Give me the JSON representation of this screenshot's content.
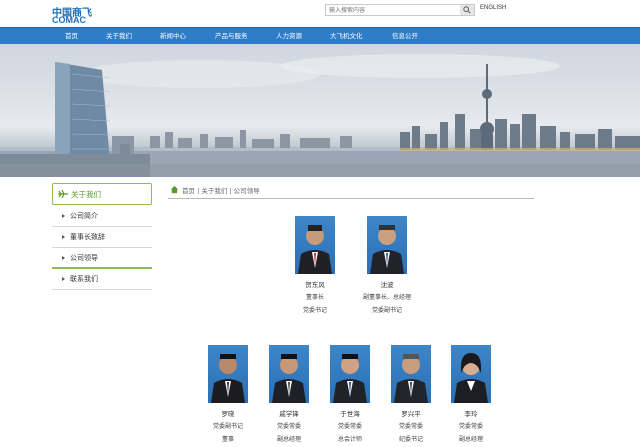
{
  "brand": {
    "name_cn": "中国商飞",
    "name_en": "COMAC",
    "accent": "#2d7dc8",
    "green": "#8bbf5a"
  },
  "search": {
    "placeholder": "输入搜索内容",
    "english_label": "ENGLISH"
  },
  "nav": {
    "items": [
      {
        "label": "首页"
      },
      {
        "label": "关于我们"
      },
      {
        "label": "新闻中心"
      },
      {
        "label": "产品与服务"
      },
      {
        "label": "人力资源"
      },
      {
        "label": "大飞机文化"
      },
      {
        "label": "信息公开"
      }
    ]
  },
  "sidebar": {
    "title": "关于我们",
    "items": [
      {
        "label": "公司简介"
      },
      {
        "label": "董事长致辞"
      },
      {
        "label": "公司领导",
        "active": true
      },
      {
        "label": "联系我们"
      }
    ]
  },
  "breadcrumb": {
    "text": "首页 | 关于我们 | 公司领导"
  },
  "leaders": [
    {
      "name": "贺东风",
      "role1": "董事长",
      "role2": "党委书记",
      "role3": ""
    },
    {
      "name": "沈波",
      "role1": "副董事长、总经理",
      "role2": "党委副书记",
      "role3": ""
    },
    {
      "name": "罗晓",
      "role1": "党委副书记",
      "role2": "董事",
      "role3": ""
    },
    {
      "name": "戚学锋",
      "role1": "党委常委",
      "role2": "副总经理",
      "role3": ""
    },
    {
      "name": "于世海",
      "role1": "党委常委",
      "role2": "总会计师",
      "role3": ""
    },
    {
      "name": "罗兴平",
      "role1": "党委常委",
      "role2": "纪委书记",
      "role3": ""
    },
    {
      "name": "李玲",
      "role1": "党委常委",
      "role2": "副总经理",
      "role3": ""
    }
  ]
}
